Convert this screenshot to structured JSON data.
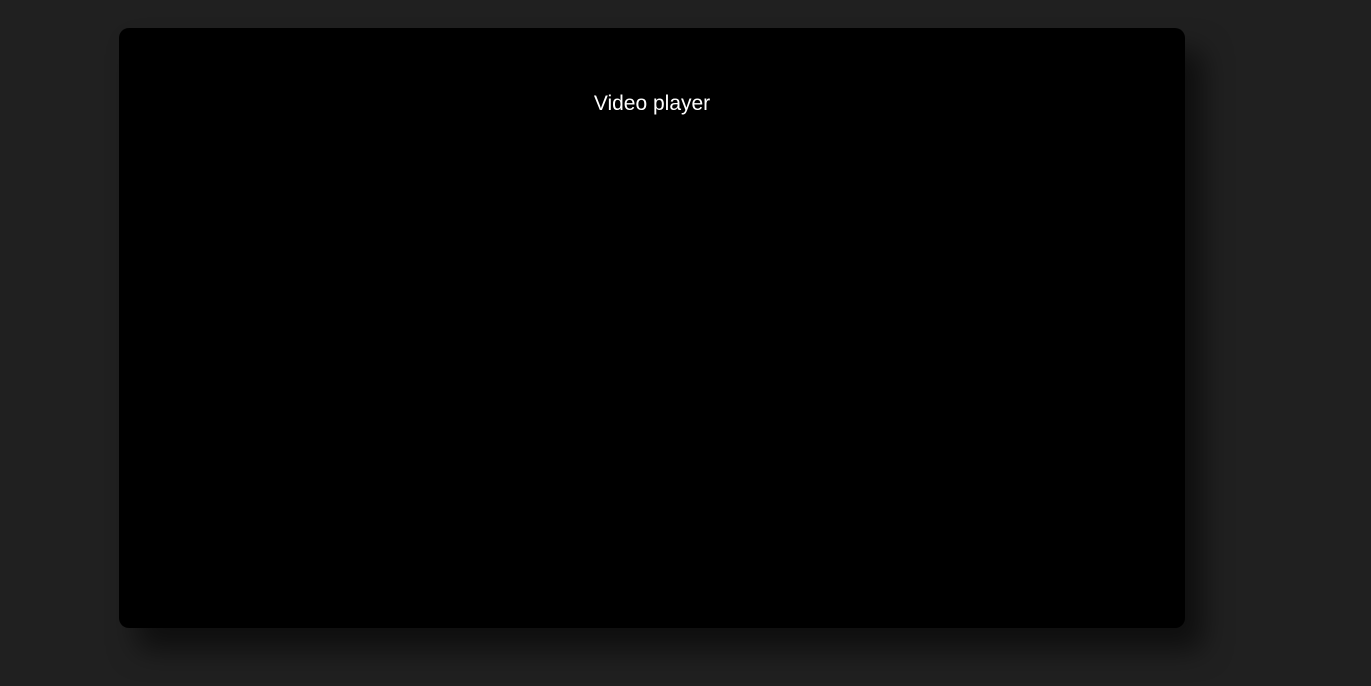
{
  "player": {
    "title": "Video player"
  },
  "colors": {
    "page_background": "#202020",
    "player_background": "#000000",
    "title_text": "#ffffff"
  }
}
